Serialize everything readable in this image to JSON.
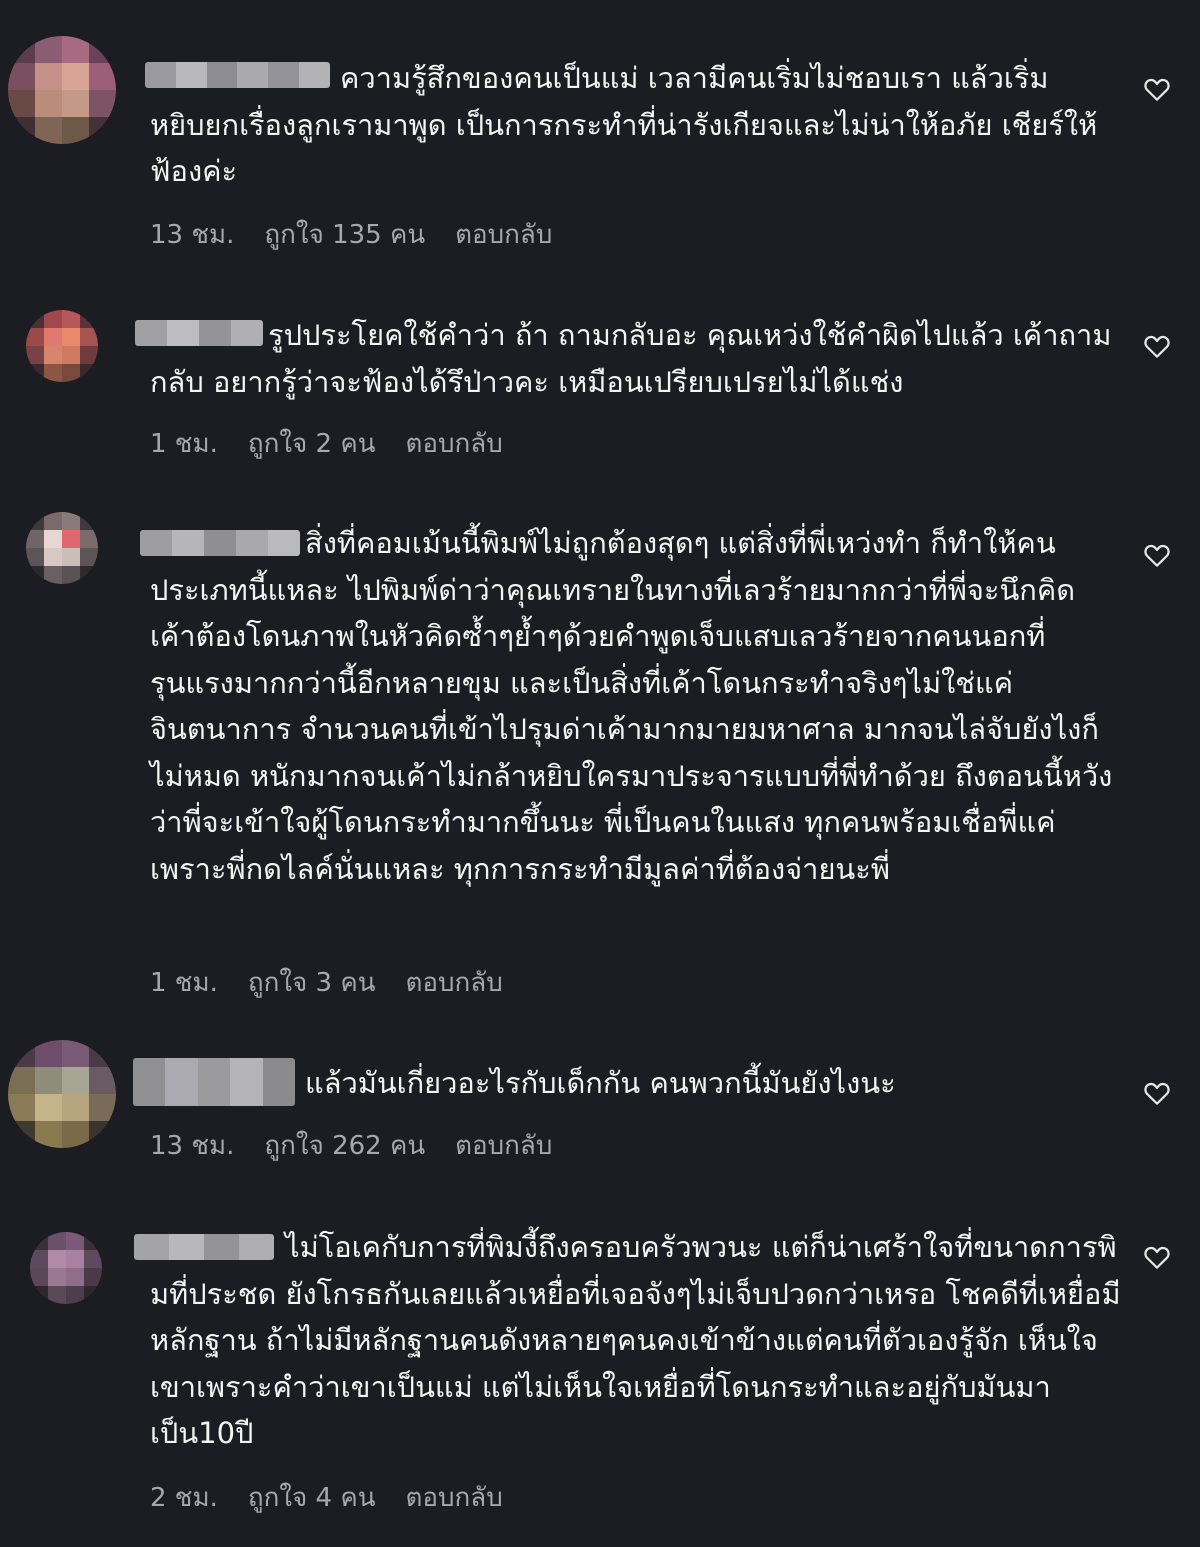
{
  "comments": [
    {
      "username": "",
      "text": "ความรู้สึกของคนเป็นแม่ เวลามีคนเริ่มไม่ชอบเรา แล้วเริ่มหยิบยกเรื่องลูกเรามาพูด เป็นการกระทำที่น่ารังเกียจและไม่น่าให้อภัย เชียร์ให้ฟ้องค่ะ",
      "time": "13 ชม.",
      "likes": "ถูกใจ 135 คน",
      "reply": "ตอบกลับ",
      "like_icon": "heart-outline-icon"
    },
    {
      "username": "",
      "text": "รูปประโยคใช้คำว่า ถ้า ถามกลับอะ คุณเหว่งใช้คำผิดไปแล้ว เค้าถามกลับ อยากรู้ว่าจะฟ้องได้รึป่าวคะ เหมือนเปรียบเปรยไม่ได้แช่ง",
      "time": "1 ชม.",
      "likes": "ถูกใจ 2 คน",
      "reply": "ตอบกลับ",
      "like_icon": "heart-outline-icon"
    },
    {
      "username": "",
      "text": "สิ่งที่คอมเม้นนี้พิมพ์ไม่ถูกต้องสุดๆ แต่สิ่งที่พี่เหว่งทำ ก็ทำให้คนประเภทนี้แหละ ไปพิมพ์ด่าว่าคุณเทรายในทางที่เลวร้ายมากกว่าที่พี่จะนึกคิด เค้าต้องโดนภาพในหัวคิดซ้ำๆย้ำๆด้วยคำพูดเจ็บแสบเลวร้ายจากคนนอกที่รุนแรงมากกว่านี้อีกหลายขุม และเป็นสิ่งที่เค้าโดนกระทำจริงๆไม่ใช่แค่จินตนาการ จำนวนคนที่เข้าไปรุมด่าเค้ามากมายมหาศาล มากจนไล่จับยังไงก็ไม่หมด หนักมากจนเค้าไม่กล้าหยิบใครมาประจารแบบที่พี่ทำด้วย ถึงตอนนี้หวังว่าพี่จะเข้าใจผู้โดนกระทำมากขึ้นนะ พี่เป็นคนในแสง ทุกคนพร้อมเชื่อพี่แค่เพราะพี่กดไลค์นั่นแหละ ทุกการกระทำมีมูลค่าที่ต้องจ่ายนะพี่",
      "time": "1 ชม.",
      "likes": "ถูกใจ 3 คน",
      "reply": "ตอบกลับ",
      "like_icon": "heart-outline-icon"
    },
    {
      "username": "",
      "text": "แล้วมันเกี่ยวอะไรกับเด็กกัน คนพวกนี้มันยังไงนะ",
      "time": "13 ชม.",
      "likes": "ถูกใจ 262 คน",
      "reply": "ตอบกลับ",
      "like_icon": "heart-outline-icon"
    },
    {
      "username": "",
      "text": "ไม่โอเคกับการที่พิมงี้ถึงครอบครัวพวนะ แต่ก็น่าเศร้าใจที่ขนาดการพิมที่ประชด ยังโกรธกันเลยแล้วเหยื่อที่เจอจังๆไม่เจ็บปวดกว่าเหรอ โชคดีที่เหยื่อมีหลักฐาน ถ้าไม่มีหลักฐานคนดังหลายๆคนคงเข้าข้างแต่คนที่ตัวเองรู้จัก เห็นใจเขาเพราะคำว่าเขาเป็นแม่ แต่ไม่เห็นใจเหยื่อที่โดนกระทำและอยู่กับมันมาเป็น10ปี",
      "time": "2 ชม.",
      "likes": "ถูกใจ 4 คน",
      "reply": "ตอบกลับ",
      "like_icon": "heart-outline-icon"
    }
  ],
  "colors": {
    "background": "#1c1d22",
    "text": "#f4f4f4",
    "meta": "#a7a8ad"
  }
}
